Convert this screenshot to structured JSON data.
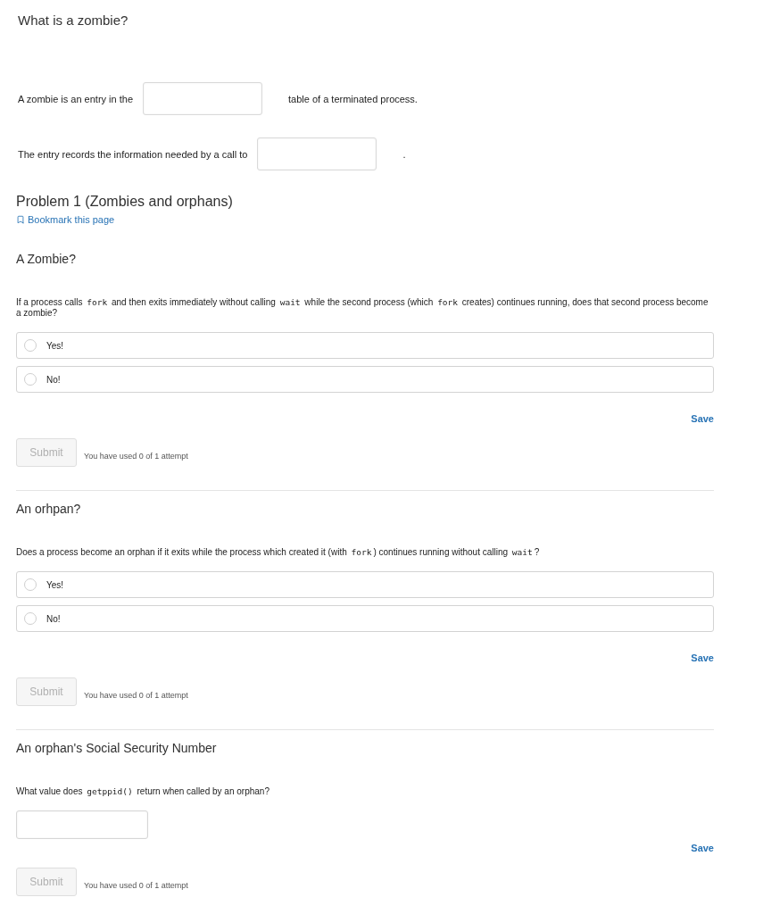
{
  "intro": {
    "title": "What is a zombie?",
    "sentences": [
      {
        "parts": [
          {
            "kind": "text",
            "text": "A zombie is an entry in the"
          },
          {
            "kind": "blank"
          },
          {
            "kind": "text",
            "text": "table of a terminated process."
          }
        ]
      },
      {
        "parts": [
          {
            "kind": "text",
            "text": "The entry records the information needed by a call to"
          },
          {
            "kind": "blank"
          },
          {
            "kind": "text",
            "text": "."
          }
        ]
      }
    ]
  },
  "problem": {
    "title": "Problem 1 (Zombies and orphans)",
    "bookmark": "Bookmark this page"
  },
  "questions": [
    {
      "kind": "choice",
      "title": "A Zombie?",
      "prompt": [
        {
          "kind": "text",
          "text": "If a process calls "
        },
        {
          "kind": "code",
          "text": "fork"
        },
        {
          "kind": "text",
          "text": " and then exits immediately without calling "
        },
        {
          "kind": "code",
          "text": "wait"
        },
        {
          "kind": "text",
          "text": " while the second process (which "
        },
        {
          "kind": "code",
          "text": "fork"
        },
        {
          "kind": "text",
          "text": " creates) continues running, does that second process become a zombie?"
        }
      ],
      "options": [
        {
          "label": "Yes!",
          "selected": false
        },
        {
          "label": "No!",
          "selected": false
        }
      ],
      "save": "Save",
      "submit": {
        "label": "Submit",
        "disabled": true
      },
      "attempts": "You have used 0 of 1 attempt"
    },
    {
      "kind": "choice",
      "title": "An orhpan?",
      "prompt": [
        {
          "kind": "text",
          "text": "Does a process become an orphan if it exits while the process which created it (with "
        },
        {
          "kind": "code",
          "text": "fork"
        },
        {
          "kind": "text",
          "text": ") continues running without calling "
        },
        {
          "kind": "code",
          "text": "wait"
        },
        {
          "kind": "text",
          "text": "?"
        }
      ],
      "options": [
        {
          "label": "Yes!",
          "selected": false
        },
        {
          "label": "No!",
          "selected": false
        }
      ],
      "save": "Save",
      "submit": {
        "label": "Submit",
        "disabled": true
      },
      "attempts": "You have used 0 of 1 attempt"
    },
    {
      "kind": "text",
      "title": "An orphan's Social Security Number",
      "prompt": [
        {
          "kind": "text",
          "text": "What value does "
        },
        {
          "kind": "code",
          "text": "getppid()"
        },
        {
          "kind": "text",
          "text": " return when called by an orphan?"
        }
      ],
      "save": "Save",
      "submit": {
        "label": "Submit",
        "disabled": true
      },
      "attempts": "You have used 0 of 1 attempt"
    }
  ]
}
